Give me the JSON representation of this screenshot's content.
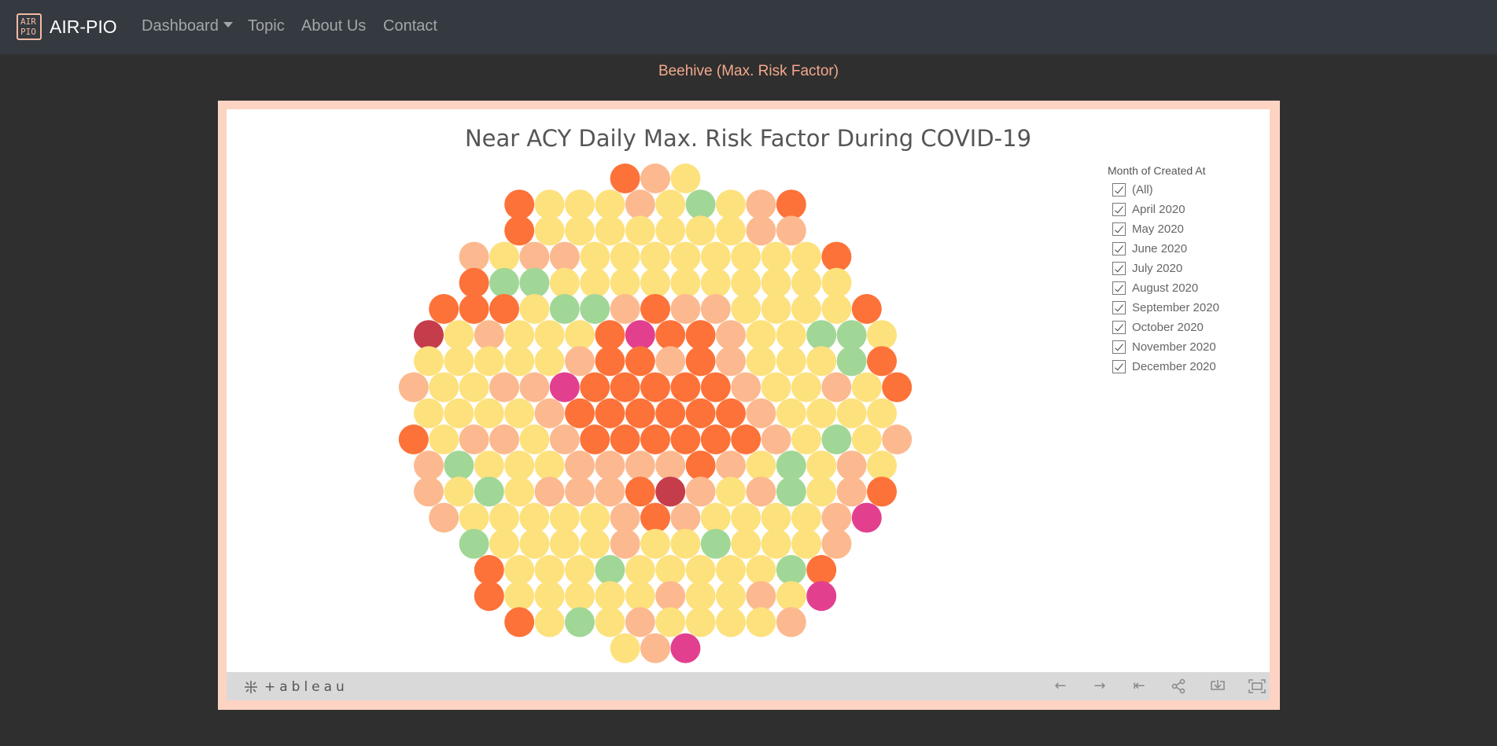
{
  "navbar": {
    "brand_name": "AIR-PIO",
    "logo_text": "AIR PIO",
    "items": [
      {
        "label": "Dashboard",
        "has_caret": true
      },
      {
        "label": "Topic"
      },
      {
        "label": "About Us"
      },
      {
        "label": "Contact"
      }
    ]
  },
  "page": {
    "heading": "Beehive (Max. Risk Factor)"
  },
  "viz": {
    "title": "Near ACY Daily Max. Risk Factor During COVID-19",
    "legend": {
      "title": "Month of Created At",
      "items": [
        {
          "label": "(All)",
          "checked": true
        },
        {
          "label": "April 2020",
          "checked": true
        },
        {
          "label": "May 2020",
          "checked": true
        },
        {
          "label": "June 2020",
          "checked": true
        },
        {
          "label": "July 2020",
          "checked": true
        },
        {
          "label": "August 2020",
          "checked": true
        },
        {
          "label": "September 2020",
          "checked": true
        },
        {
          "label": "October 2020",
          "checked": true
        },
        {
          "label": "November 2020",
          "checked": true
        },
        {
          "label": "December 2020",
          "checked": true
        }
      ]
    },
    "toolbar": {
      "logo_text": "+ableau",
      "buttons": [
        "undo-icon",
        "redo-icon",
        "revert-icon",
        "share-icon",
        "download-icon",
        "fullscreen-icon"
      ]
    }
  },
  "chart_data": {
    "type": "beehive",
    "title": "Near ACY Daily Max. Risk Factor During COVID-19",
    "colors": {
      "Y": "#fde17d",
      "P": "#fcb98f",
      "O": "#fd7239",
      "G": "#a1d796",
      "M": "#e2408f",
      "R": "#c53d4b"
    },
    "rows": [
      "OPY",
      "OYYYPYGYPO",
      "OYYYYYYYPP",
      "PYPPYYYYYYYYO",
      "OGGYYYYYYYYYY",
      "OOOYGGPOPPYYYYO",
      "RYPYYYOMOOPYYGGY",
      "YYYYYPOOPOPYYYGO",
      "PYYPPMOOOOOPYYPYO",
      "YYYYPOOOOOOPYYYY",
      "OYPPYPOOOOOOPYGYP",
      "PGYYYPPPPOPYGYPY",
      "PYGYPPPORPYPGYPO",
      "PYYYYYPOPYYYYPM",
      "GYYYYPYYGYYYP",
      "OYYYGYYYYYGO",
      "OYYYYYPYYPYM",
      "OYGYPYYYYP",
      "YPM"
    ]
  }
}
